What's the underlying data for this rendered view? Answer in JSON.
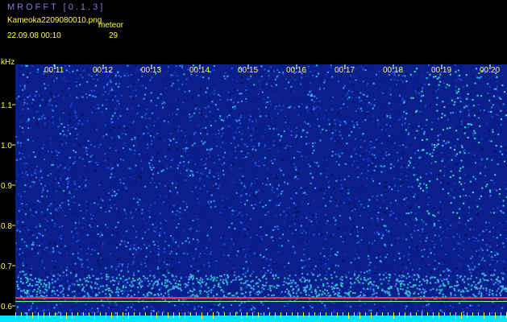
{
  "app": {
    "title": "MROFFT [0.1.3]",
    "file_name": "Kameoka2209080010.png",
    "date_time": "22.09.08 00:10",
    "label": "meteor",
    "count": "29"
  },
  "axis": {
    "unit": "kHz",
    "y_ticks": [
      "1.1",
      "1.0",
      "0.9",
      "0.8",
      "0.7",
      "0.6"
    ],
    "x_ticks": [
      "00:11",
      "00:12",
      "00:13",
      "00:14",
      "00:15",
      "00:16",
      "00:17",
      "00:18",
      "00:19",
      "00:20"
    ]
  },
  "colors": {
    "background": "#000000",
    "field": "#0a1e8c",
    "accent_text": "#ffff33",
    "title_text": "#7a7ce0",
    "baseline": "#00e5ff",
    "signal_line": "#ff3355"
  }
}
